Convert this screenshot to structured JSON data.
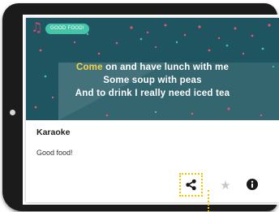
{
  "card": {
    "tag_label": "GOOD FOOD!",
    "lyrics": {
      "line1_highlight": "Come",
      "line1_rest": " on and have lunch with me",
      "line2": "Some soup with peas",
      "line3": "And to drink I really need iced tea"
    },
    "title": "Karaoke",
    "description": "Good food!"
  },
  "actions": {
    "share_icon": "share-icon",
    "favorite_icon": "star-icon",
    "info_icon": "info-icon"
  },
  "colors": {
    "banner_background": "#1e5560",
    "lyric_highlight": "#f3d24a",
    "tag_background": "#45c4a7",
    "focus_outline": "#f2c300"
  }
}
